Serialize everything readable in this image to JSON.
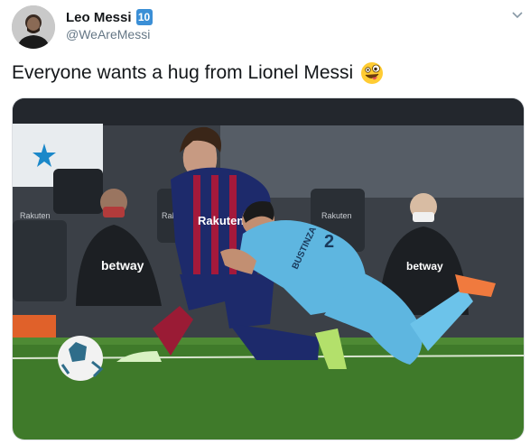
{
  "tweet": {
    "author_name": "Leo Messi",
    "author_badge": "10",
    "author_handle": "@WeAreMessi",
    "text": "Everyone wants a hug from Lionel Messi",
    "emoji_name": "zany-face-emoji",
    "media": {
      "jersey_messi_sponsor": "Rakuten",
      "jersey_opponent_name": "BUSTINZA",
      "jersey_opponent_number": "2",
      "bench_shirt_sponsor": "betway",
      "background_board_text": "Rakuten",
      "icons": [
        "ball-icon",
        "star-logo-icon"
      ]
    }
  },
  "colors": {
    "badge": "#3b8fd6",
    "text_primary": "#14171a",
    "text_secondary": "#657786",
    "pitch": "#3f7a2a",
    "barca_blue": "#1d2a6b",
    "barca_red": "#a4193b",
    "opponent_kit": "#5eb6e0"
  }
}
